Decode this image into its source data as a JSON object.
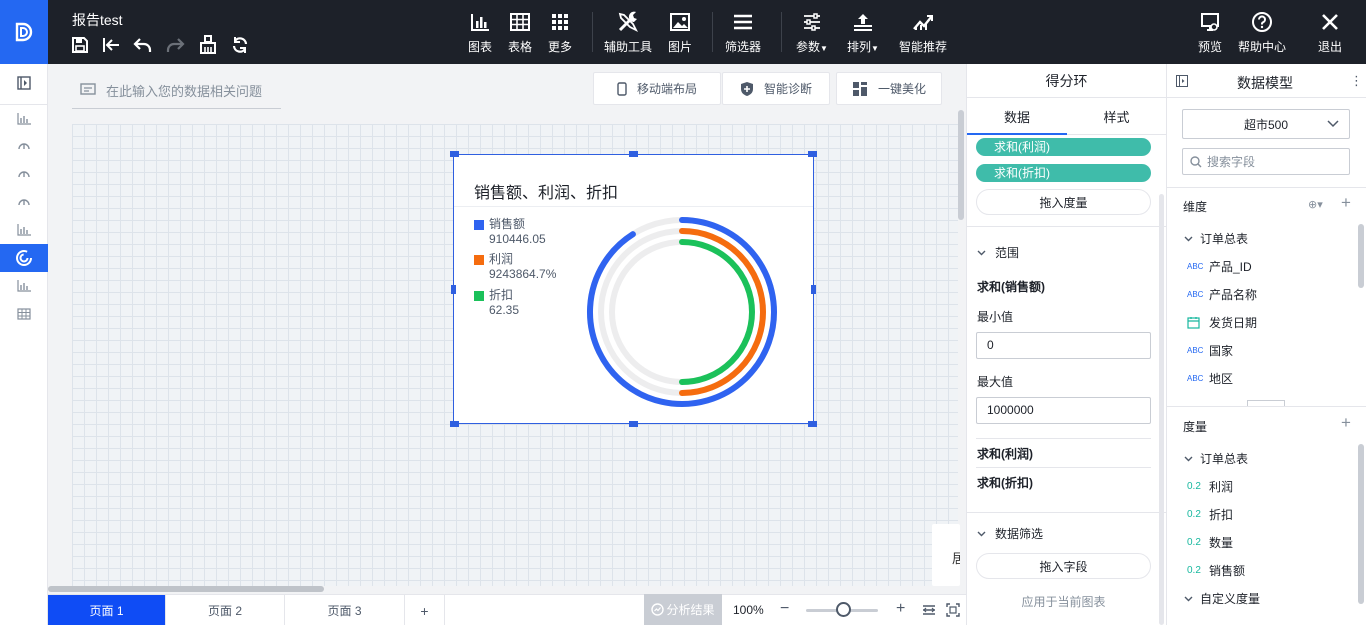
{
  "header": {
    "report_title": "报告test",
    "toolbar": [
      {
        "label": "图表",
        "icon": "bar-chart-icon"
      },
      {
        "label": "表格",
        "icon": "table-icon"
      },
      {
        "label": "更多",
        "icon": "grid-more-icon"
      },
      {
        "label": "辅助工具",
        "icon": "tools-icon"
      },
      {
        "label": "图片",
        "icon": "image-icon"
      },
      {
        "label": "筛选器",
        "icon": "filter-list-icon"
      },
      {
        "label": "参数",
        "icon": "sliders-icon"
      },
      {
        "label": "排列",
        "icon": "arrange-icon"
      },
      {
        "label": "智能推荐",
        "icon": "smart-chart-icon"
      }
    ],
    "right_actions": [
      {
        "label": "预览",
        "icon": "preview-icon"
      },
      {
        "label": "帮助中心",
        "icon": "help-icon"
      },
      {
        "label": "退出",
        "icon": "close-icon"
      }
    ]
  },
  "canvas": {
    "ask_placeholder": "在此输入您的数据相关问题",
    "buttons": [
      "移动端布局",
      "智能诊断",
      "一键美化"
    ],
    "stub_text": "居"
  },
  "chart_data": {
    "type": "radial-ring",
    "title": "销售额、利润、折扣",
    "series": [
      {
        "name": "销售额",
        "value_label": "910446.05",
        "value": 910446.05,
        "max": 1000000,
        "color": "#2f63f0"
      },
      {
        "name": "利润",
        "value_label": "9243864.7%",
        "color": "#f56c0f"
      },
      {
        "name": "折扣",
        "value_label": "62.35",
        "color": "#1bc15a"
      }
    ]
  },
  "pages": {
    "tabs": [
      "页面 1",
      "页面 2",
      "页面 3"
    ],
    "add_label": "+",
    "analysis_label": "分析结果",
    "zoom": "100%",
    "active_index": 0
  },
  "config": {
    "title": "得分环",
    "tabs": [
      "数据",
      "样式"
    ],
    "measures": [
      "求和(利润)",
      "求和(折扣)"
    ],
    "drop_measure": "拖入度量",
    "range_section": "范围",
    "range_field": "求和(销售额)",
    "min_label": "最小值",
    "min_value": "0",
    "max_label": "最大值",
    "max_value": "1000000",
    "collapsed_fields": [
      "求和(利润)",
      "求和(折扣)"
    ],
    "filter_section": "数据筛选",
    "drop_field": "拖入字段",
    "apply_label": "应用于当前图表"
  },
  "model": {
    "title": "数据模型",
    "dataset": "超市500",
    "search_placeholder": "搜索字段",
    "dimensions_label": "维度",
    "dim_group": "订单总表",
    "dimensions": [
      {
        "type": "ABC",
        "name": "产品_ID"
      },
      {
        "type": "ABC",
        "name": "产品名称"
      },
      {
        "type": "date",
        "name": "发货日期"
      },
      {
        "type": "ABC",
        "name": "国家"
      },
      {
        "type": "ABC",
        "name": "地区"
      }
    ],
    "measures_label": "度量",
    "measure_group": "订单总表",
    "measures": [
      {
        "type": "0.2",
        "name": "利润"
      },
      {
        "type": "0.2",
        "name": "折扣"
      },
      {
        "type": "0.2",
        "name": "数量"
      },
      {
        "type": "0.2",
        "name": "销售额"
      }
    ],
    "custom_group": "自定义度量"
  }
}
